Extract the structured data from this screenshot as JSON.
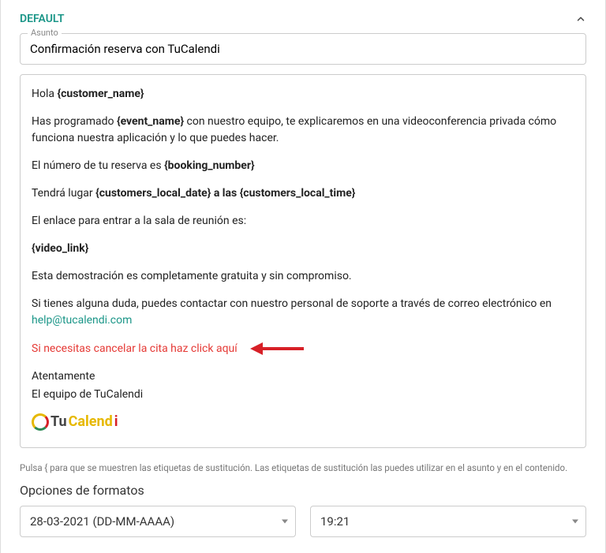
{
  "panel": {
    "title": "DEFAULT"
  },
  "subject": {
    "label": "Asunto",
    "value": "Confirmación reserva con TuCalendi"
  },
  "body": {
    "greeting_prefix": "Hola ",
    "greeting_var": "{customer_name}",
    "line2_a": "Has programado ",
    "line2_var": "{event_name}",
    "line2_b": " con nuestro equipo, te explicaremos en una videoconferencia privada cómo funciona nuestra aplicación y lo que puedes hacer.",
    "line3_a": "El número de tu reserva es ",
    "line3_var": "{booking_number}",
    "line4_a": "Tendrá lugar ",
    "line4_var1": "{customers_local_date}",
    "line4_mid": " a las ",
    "line4_var2": "{customers_local_time}",
    "line5": "El enlace para entrar a la sala de reunión es:",
    "line6_var": "{video_link}",
    "line7": "Esta demostración es completamente gratuita y sin compromiso.",
    "line8_a": "Si tienes alguna duda, puedes contactar con nuestro personal de soporte a través de correo electrónico en ",
    "line8_email": "help@tucalendi.com",
    "cancel_text": "Si necesitas cancelar la cita haz click aquí",
    "sign1": "Atentamente",
    "sign2": "El equipo de TuCalendi",
    "logo_tu": "Tu",
    "logo_calend": "Calend",
    "logo_i": "i"
  },
  "help_text": "Pulsa { para que se muestren las etiquetas de sustitución. Las etiquetas de sustitución las puedes utilizar en el asunto y en el contenido.",
  "format": {
    "section_label": "Opciones de formatos",
    "date_value": "28-03-2021 (DD-MM-AAAA)",
    "time_value": "19:21"
  }
}
